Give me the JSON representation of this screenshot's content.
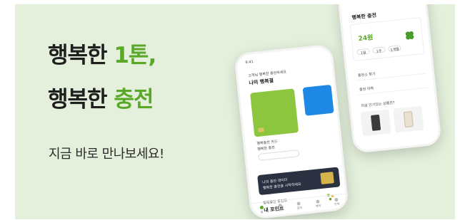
{
  "headline": {
    "line1_prefix": "행복한 ",
    "line1_accent": "1톤,",
    "line2_prefix": "행복한 ",
    "line2_accent": "충전"
  },
  "subline": "지금 바로 만나보세요!",
  "colors": {
    "background": "#e4f0dc",
    "accent_green": "#5aa828",
    "text_dark": "#1f1f1f"
  },
  "phone_front": {
    "status_time": "9:41",
    "greeting": "고객님 행복한 충전하세요",
    "wallet_title": "나의 행복결",
    "card_label": "행복충전 카드",
    "card_sub": "행복한 충전",
    "promo_line1": "나의 충전 데이터",
    "promo_line2": "행복한 충전을 시작하세요",
    "point_label": "행복충전 포인트",
    "point_value": "내 포인트",
    "tabs": [
      "홈",
      "충전",
      "결제",
      "혜택",
      "전체"
    ]
  },
  "phone_back": {
    "title": "행복한 충전",
    "value": "24원",
    "pills": [
      "1일",
      "1주",
      "1개월"
    ],
    "rows": [
      "충전소 찾기",
      "충전 이력"
    ],
    "products_title": "지금 인기있는 상품은?"
  }
}
